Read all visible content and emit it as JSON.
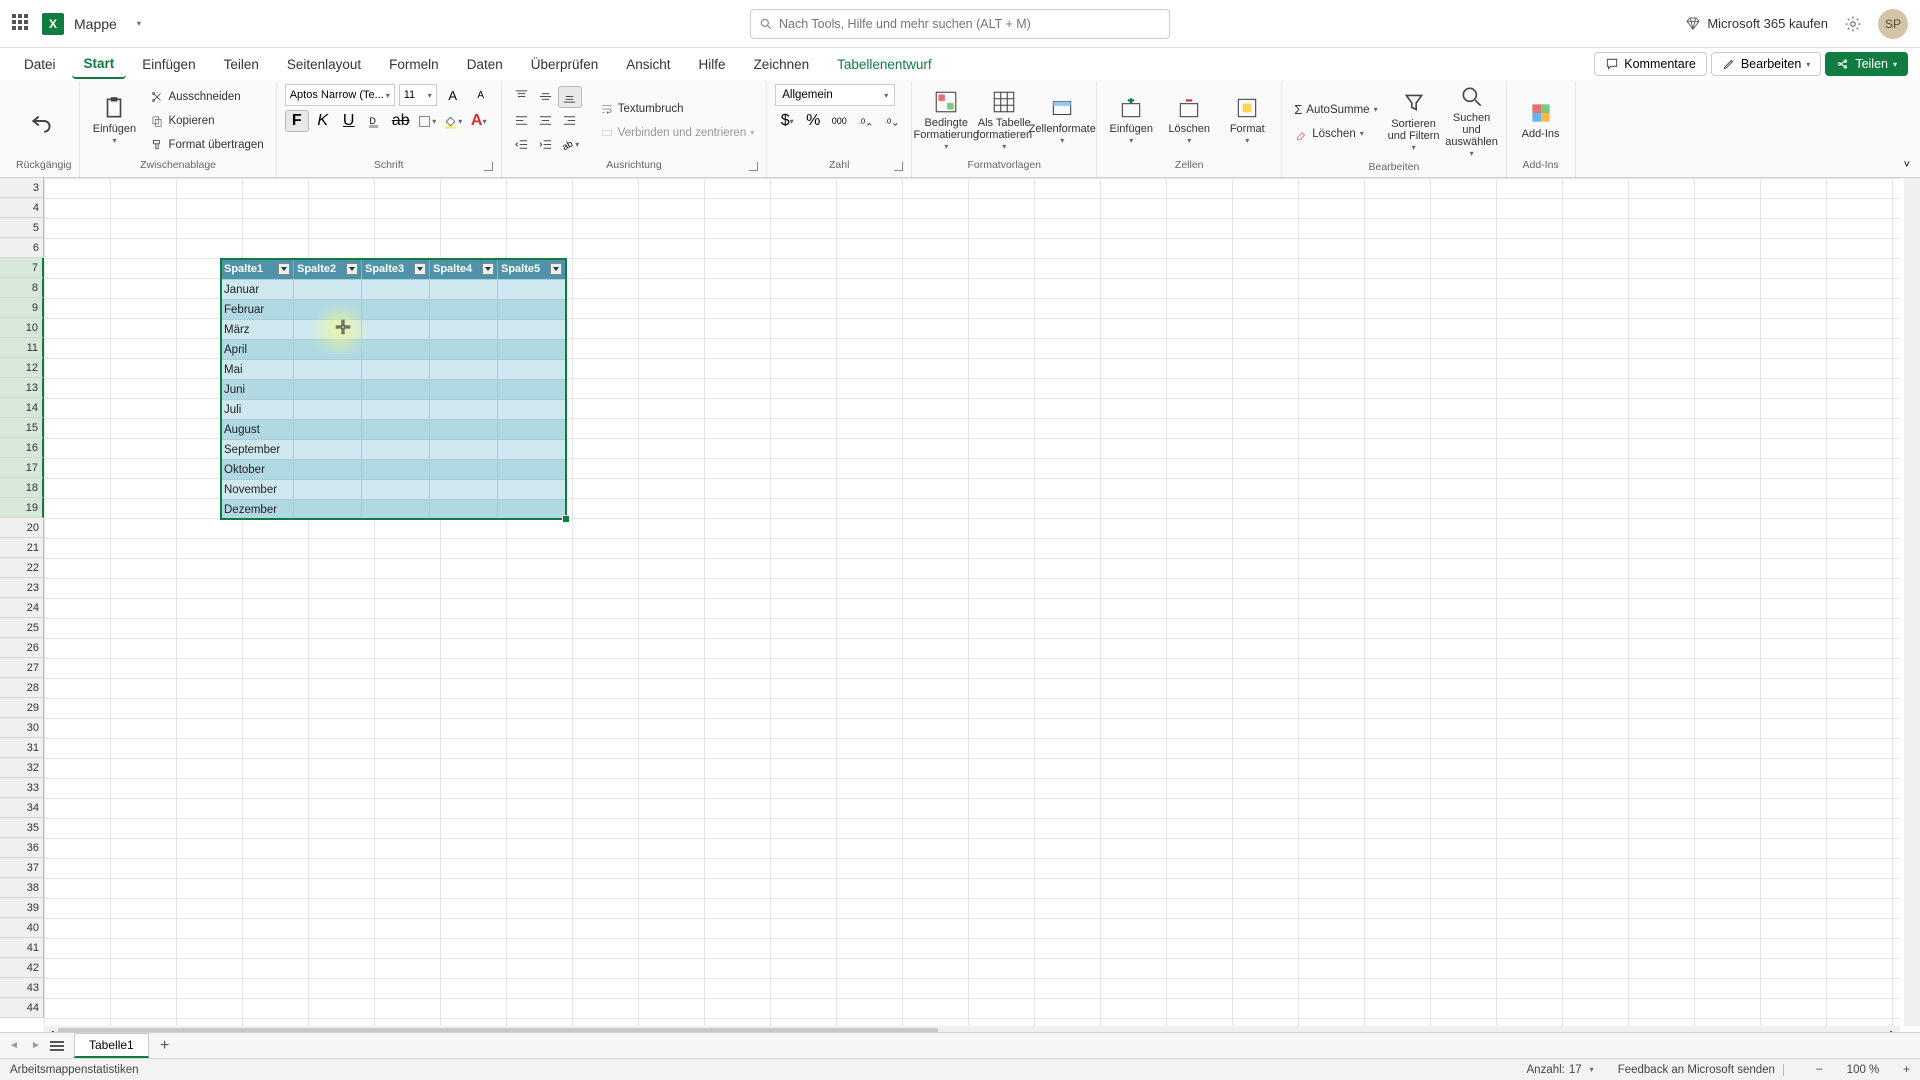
{
  "title": {
    "doc_name": "Mappe"
  },
  "search": {
    "placeholder": "Nach Tools, Hilfe und mehr suchen (ALT + M)"
  },
  "header_right": {
    "buy": "Microsoft 365 kaufen",
    "avatar": "SP"
  },
  "menu": {
    "tabs": [
      "Datei",
      "Start",
      "Einfügen",
      "Teilen",
      "Seitenlayout",
      "Formeln",
      "Daten",
      "Überprüfen",
      "Ansicht",
      "Hilfe",
      "Zeichnen",
      "Tabellenentwurf"
    ],
    "comments": "Kommentare",
    "editing": "Bearbeiten",
    "share": "Teilen"
  },
  "ribbon": {
    "undo_group": "Rückgängig",
    "paste": "Einfügen",
    "cut": "Ausschneiden",
    "copy": "Kopieren",
    "format_painter": "Format übertragen",
    "clipboard_group": "Zwischenablage",
    "font_name": "Aptos Narrow (Te...",
    "font_size": "11",
    "bold": "F",
    "italic": "K",
    "underline": "U",
    "font_group": "Schrift",
    "wrap": "Textumbruch",
    "merge": "Verbinden und zentrieren",
    "align_group": "Ausrichtung",
    "number_format": "Allgemein",
    "number_group": "Zahl",
    "cond_fmt": "Bedingte Formatierung",
    "as_table": "Als Tabelle formatieren",
    "cell_styles": "Zellenformate",
    "styles_group": "Formatvorlagen",
    "insert": "Einfügen",
    "delete": "Löschen",
    "format": "Format",
    "cells_group": "Zellen",
    "autosum": "AutoSumme",
    "clear": "Löschen",
    "sort_filter": "Sortieren und Filtern",
    "find_select": "Suchen und auswählen",
    "editing_group": "Bearbeiten",
    "addins": "Add-Ins",
    "addins_group": "Add-Ins"
  },
  "grid": {
    "row_start": 3,
    "row_count": 42,
    "col_count": 28,
    "selected_row": 7
  },
  "table": {
    "headers": [
      "Spalte1",
      "Spalte2",
      "Spalte3",
      "Spalte4",
      "Spalte5"
    ],
    "rows": [
      "Januar",
      "Februar",
      "März",
      "April",
      "Mai",
      "Juni",
      "Juli",
      "August",
      "September",
      "Oktober",
      "November",
      "Dezember"
    ]
  },
  "sheets": {
    "active": "Tabelle1"
  },
  "status": {
    "stats": "Arbeitsmappenstatistiken",
    "count_label": "Anzahl:",
    "count_value": "17",
    "feedback": "Feedback an Microsoft senden",
    "zoom": "100 %"
  }
}
